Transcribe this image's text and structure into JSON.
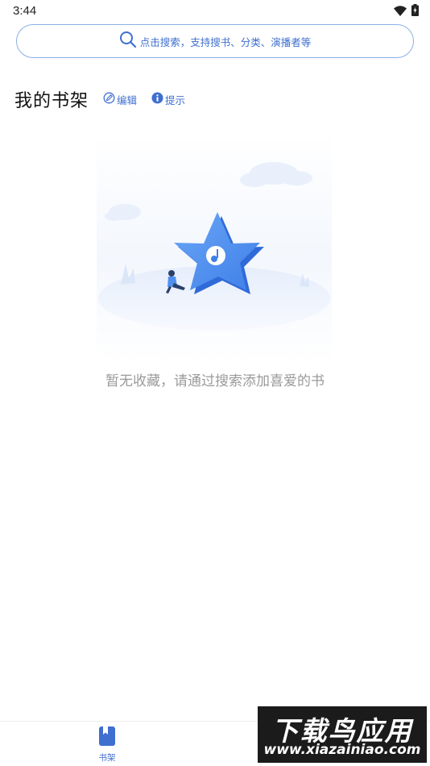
{
  "status_bar": {
    "time": "3:44",
    "icons": [
      "wifi-icon",
      "battery-charging-icon"
    ]
  },
  "search": {
    "placeholder": "点击搜索，支持搜书、分类、演播者等",
    "icon": "search-icon"
  },
  "shelf": {
    "title": "我的书架",
    "edit_label": "编辑",
    "edit_icon": "edit-icon",
    "hint_label": "提示",
    "hint_icon": "info-icon",
    "empty_message": "暂无收藏，请通过搜索添加喜爱的书",
    "empty_illustration": "star-with-person-illustration"
  },
  "bottom_nav": {
    "items": [
      {
        "label": "书架",
        "icon": "bookshelf-icon",
        "active": true
      }
    ]
  },
  "watermark": {
    "title": "下载鸟应用",
    "url": "www.xiazainiao.com"
  },
  "colors": {
    "accent": "#3f6fcf",
    "search_border": "#8ab0e6",
    "empty_text": "#9a9a9a",
    "star": "#4f8ff0"
  }
}
